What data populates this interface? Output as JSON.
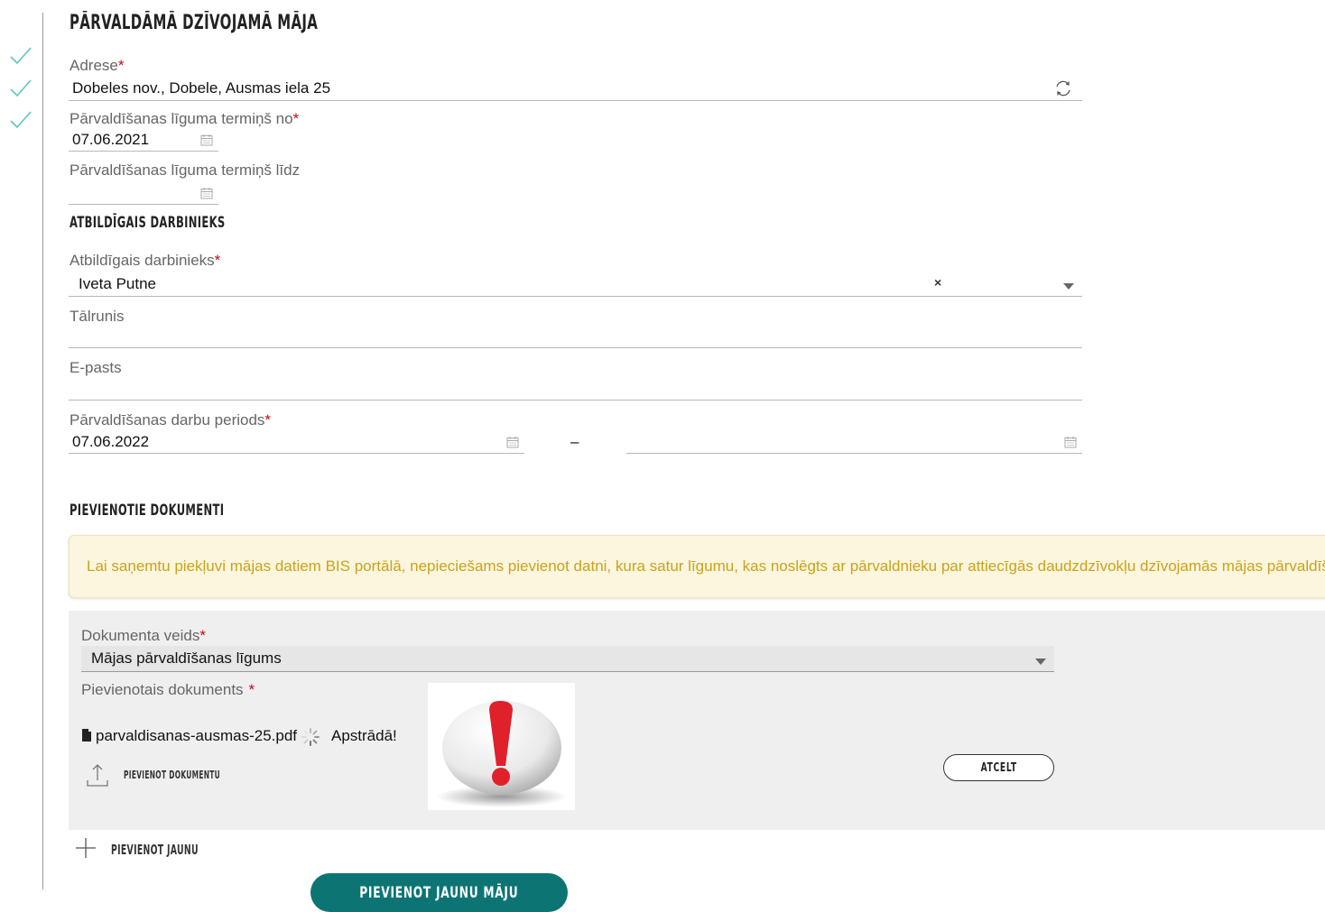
{
  "page_title": "PĀRVALDĀMĀ DZĪVOJAMĀ MĀJA",
  "steps": [
    {
      "status": "completed",
      "icon": "check-icon"
    },
    {
      "status": "completed",
      "icon": "check-icon"
    },
    {
      "status": "completed",
      "icon": "check-icon"
    }
  ],
  "address": {
    "label": "Adrese",
    "required_mark": "*",
    "value": "Dobeles nov., Dobele, Ausmas iela 25",
    "icon": "refresh-icon"
  },
  "contract_from": {
    "label": "Pārvaldīšanas līguma termiņš no",
    "required_mark": "*",
    "value": "07.06.2021",
    "icon": "calendar-icon"
  },
  "contract_to": {
    "label": "Pārvaldīšanas līguma termiņš līdz",
    "value": "",
    "icon": "calendar-icon"
  },
  "responsible_section": {
    "title": "ATBILDĪGAIS DARBINIEKS",
    "employee": {
      "label": "Atbildīgais darbinieks",
      "required_mark": "*",
      "value": "Iveta Putne",
      "clear_symbol": "×"
    },
    "phone": {
      "label": "Tālrunis",
      "value": ""
    },
    "email": {
      "label": "E-pasts",
      "value": ""
    },
    "period": {
      "label": "Pārvaldīšanas darbu periods",
      "required_mark": "*",
      "from": "07.06.2022",
      "separator": "–",
      "to": ""
    }
  },
  "documents_section": {
    "title": "PIEVIENOTIE DOKUMENTI",
    "notice": "Lai saņemtu piekļuvi mājas datiem BIS portālā, nepieciešams pievienot datni, kura satur līgumu, kas noslēgts ar pārvaldnieku par attiecīgās daudzdzīvokļu dzīvojamās mājas pārvaldīšanu.",
    "doc_type": {
      "label": "Dokumenta veids",
      "required_mark": "*",
      "value": "Mājas pārvaldīšanas līgums"
    },
    "attached": {
      "label": "Pievienotais dokuments",
      "required_mark": "*",
      "file_name": "parvaldisanas-ausmas-25.pdf",
      "status": "Apstrādā!"
    },
    "upload_label": "PIEVIENOT DOKUMENTU",
    "cancel_label": "ATCELT",
    "add_new_label": "PIEVIENOT JAUNU"
  },
  "submit_label": "PIEVIENOT JAUNU MĀJU",
  "colors": {
    "primary": "#0d7474",
    "required": "#d0021b",
    "notice_text": "#c9a21c",
    "notice_bg": "#fcf6de",
    "check": "#5fc5c0",
    "warning": "#e0202a"
  }
}
